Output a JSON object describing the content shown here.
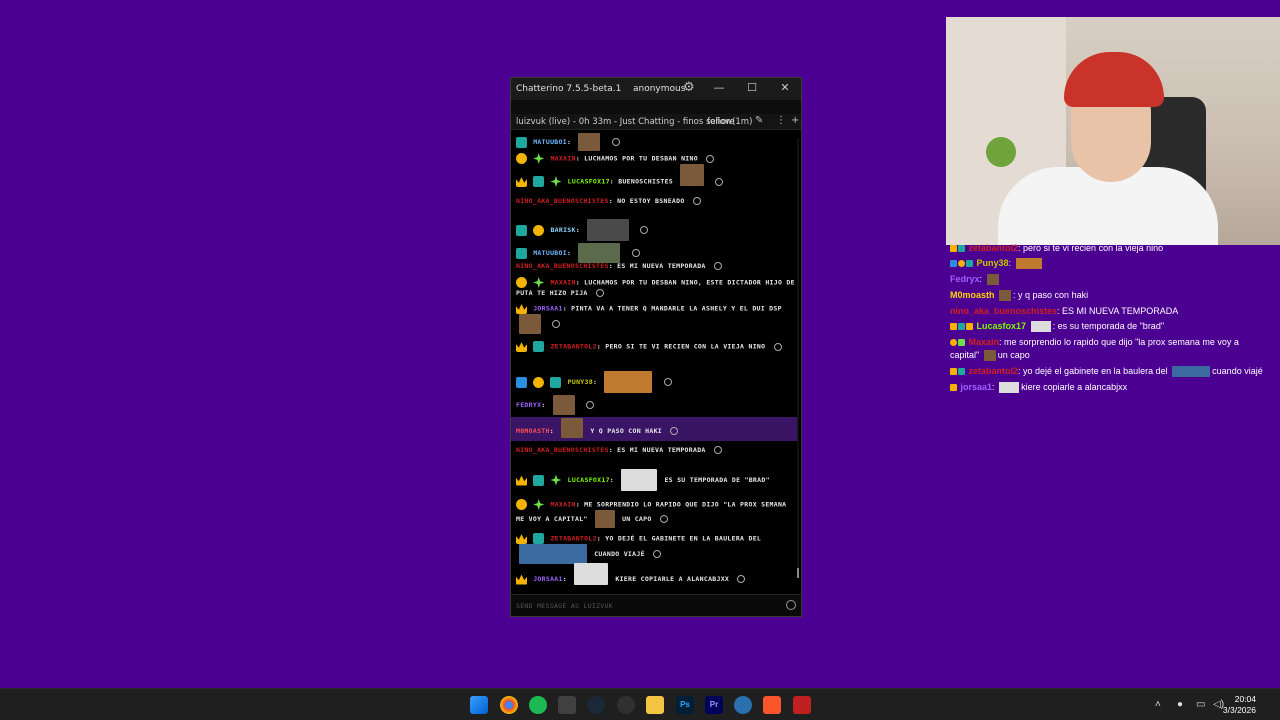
{
  "window": {
    "title": "Chatterino 7.5.5-beta.1",
    "account": "anonymous",
    "minimize": "—",
    "maximize": "☐",
    "close": "✕"
  },
  "split": {
    "header": "luizvuk (live) - 0h 33m - Just Chatting - finos señore",
    "mode": "follow(1m)",
    "more": "⋮",
    "add": "+"
  },
  "messages": [
    {
      "nick": "MATUUBOI",
      "color": "#6fb9ff",
      "text": ""
    },
    {
      "nick": "MAXAIN",
      "color": "#d02020",
      "text": "LUCHAMOS POR TU DESBAN NINO"
    },
    {
      "nick": "LUCASFOX17",
      "color": "#7cfc00",
      "text": "BUENOSCHISTES"
    },
    {
      "nick": "NINO_AKA_BUENOSCHISTES",
      "color": "#d02020",
      "text": "NO ESTOY BSNEADO"
    },
    {
      "nick": "BARISK",
      "color": "#8ad6ff",
      "text": ""
    },
    {
      "nick": "MATUUBOI",
      "color": "#6fb9ff",
      "text": ""
    },
    {
      "nick": "NINO_AKA_BUENOSCHISTES",
      "color": "#d02020",
      "text": "ES MI NUEVA TEMPORADA"
    },
    {
      "nick": "MAXAIN",
      "color": "#d02020",
      "text": "LUCHAMOS POR TU DESBAN NINO, ESTE DICTADOR HIJO DE PUTA TE HIZO PIJA"
    },
    {
      "nick": "JORSAA1",
      "color": "#a060ff",
      "text": "PINTA VA A TENER Q MANDARLE LA ASHELY Y EL DUI DSP"
    },
    {
      "nick": "ZETABANTOL2",
      "color": "#d02020",
      "text": "PERO SI TE VI RECIEN CON LA VIEJA NINO"
    },
    {
      "nick": "PUNY38",
      "color": "#c8c800",
      "text": ""
    },
    {
      "nick": "FEDRYX",
      "color": "#a060ff",
      "text": ""
    },
    {
      "nick": "M0MOASTH",
      "color": "#ff5050",
      "text": "Y Q PASO CON HAKI"
    },
    {
      "nick": "NINO_AKA_BUENOSCHISTES",
      "color": "#d02020",
      "text": "ES MI NUEVA TEMPORADA"
    },
    {
      "nick": "LUCASFOX17",
      "color": "#7cfc00",
      "text": "ES SU TEMPORADA DE \"BRAD\""
    },
    {
      "nick": "MAXAIN",
      "color": "#d02020",
      "text": "ME SORPRENDIO LO RAPIDO QUE DIJO \"LA PROX SEMANA ME VOY A CAPITAL\"",
      "text2": "UN CAPO"
    },
    {
      "nick": "ZETABANTOL2",
      "color": "#d02020",
      "text": "YO DEJÉ EL GABINETE EN LA BAULERA DEL",
      "text2": "CUANDO VIAJÉ"
    },
    {
      "nick": "JORSAA1",
      "color": "#a060ff",
      "text": "KIERE COPIARLE A ALANCABJXX"
    }
  ],
  "input_placeholder": "SEND MESSAGE AS LUIZVUK",
  "overlay": [
    {
      "nick": "zetabantol2",
      "color": "#d02020",
      "text": ": pero si te vi recien con la vieja nino"
    },
    {
      "nick": "Puny38",
      "color": "#c8c800",
      "text": ":"
    },
    {
      "nick": "Fedryx",
      "color": "#a060ff",
      "text": ":"
    },
    {
      "nick": "M0moasth",
      "color": "#ffd700",
      "text": ": y q paso con haki"
    },
    {
      "nick": "nino_aka_buenoschistes",
      "color": "#d02020",
      "text": ": ES MI NUEVA TEMPORADA"
    },
    {
      "nick": "Lucasfox17",
      "color": "#7cfc00",
      "text": ": es su temporada de \"brad\""
    },
    {
      "nick": "Maxain",
      "color": "#d02020",
      "text": ": me sorprendio lo rapido que dijo \"la prox semana me voy a"
    },
    {
      "nick": "",
      "color": "#ffffff",
      "text": "capital\"",
      "text2": "un capo"
    },
    {
      "nick": "zetabantol2",
      "color": "#d02020",
      "text": ": yo dejé el gabinete en la baulera del",
      "text2": "cuando viajé"
    },
    {
      "nick": "jorsaa1",
      "color": "#a060ff",
      "text": ":",
      "text2": "kiere copiarle a alancabjxx"
    }
  ],
  "clock": {
    "time": "20:04",
    "date": "3/3/2026"
  },
  "taskbar": {
    "apps": [
      "windows-start",
      "chrome",
      "spotify",
      "discord",
      "steam",
      "obs",
      "file-explorer",
      "photoshop",
      "premiere",
      "chatterino",
      "brave",
      "kick"
    ],
    "ps_label": "Ps",
    "pr_label": "Pr"
  }
}
